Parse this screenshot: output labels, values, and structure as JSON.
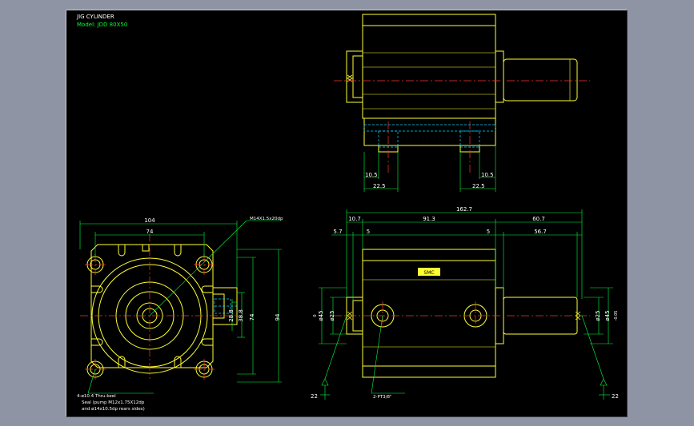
{
  "title": "JIG CYLINDER",
  "model": "Model: JDD 80X50",
  "colors": {
    "background": "#000000",
    "outline": "#ffff33",
    "center_line": "#ff3030",
    "dimension": "#00ff40",
    "hidden": "#00d8ff",
    "text": "#ffffff",
    "viewport_bg": "#8e94a4"
  },
  "top_view": {
    "dims": {
      "a": "10.5",
      "b": "22.5",
      "c": "10.5",
      "d": "22.5"
    }
  },
  "front_view": {
    "dims": {
      "width": "104",
      "bolt_spacing": "74",
      "height": "94",
      "inner_height": "74",
      "d1": "38.8",
      "d2": "28.8"
    },
    "thread_callout": "M14X1.5x20dp",
    "hole_callout_1": "4-ø10.4 Thru-keel",
    "hole_callout_2": "Seal (pump M12x1.75X12dp",
    "hole_callout_3": "and ø14x10.5dp rears sides)"
  },
  "side_view": {
    "dims": {
      "overall": "162.7",
      "left": "10.7",
      "middle": "91.3",
      "right": "60.7",
      "s1": "5.7",
      "s2": "5",
      "s3": "5",
      "s4": "56.7",
      "dia_left_1": "ø45",
      "dia_left_2": "ø25",
      "dia_right_1": "ø25",
      "dia_right_2": "ø45",
      "tol_left": "0",
      "tol_right": "-0.05",
      "flat_left": "22",
      "flat_right": "22"
    },
    "port_callout": "2-PT3/8\"",
    "nameplate": "SMC"
  }
}
